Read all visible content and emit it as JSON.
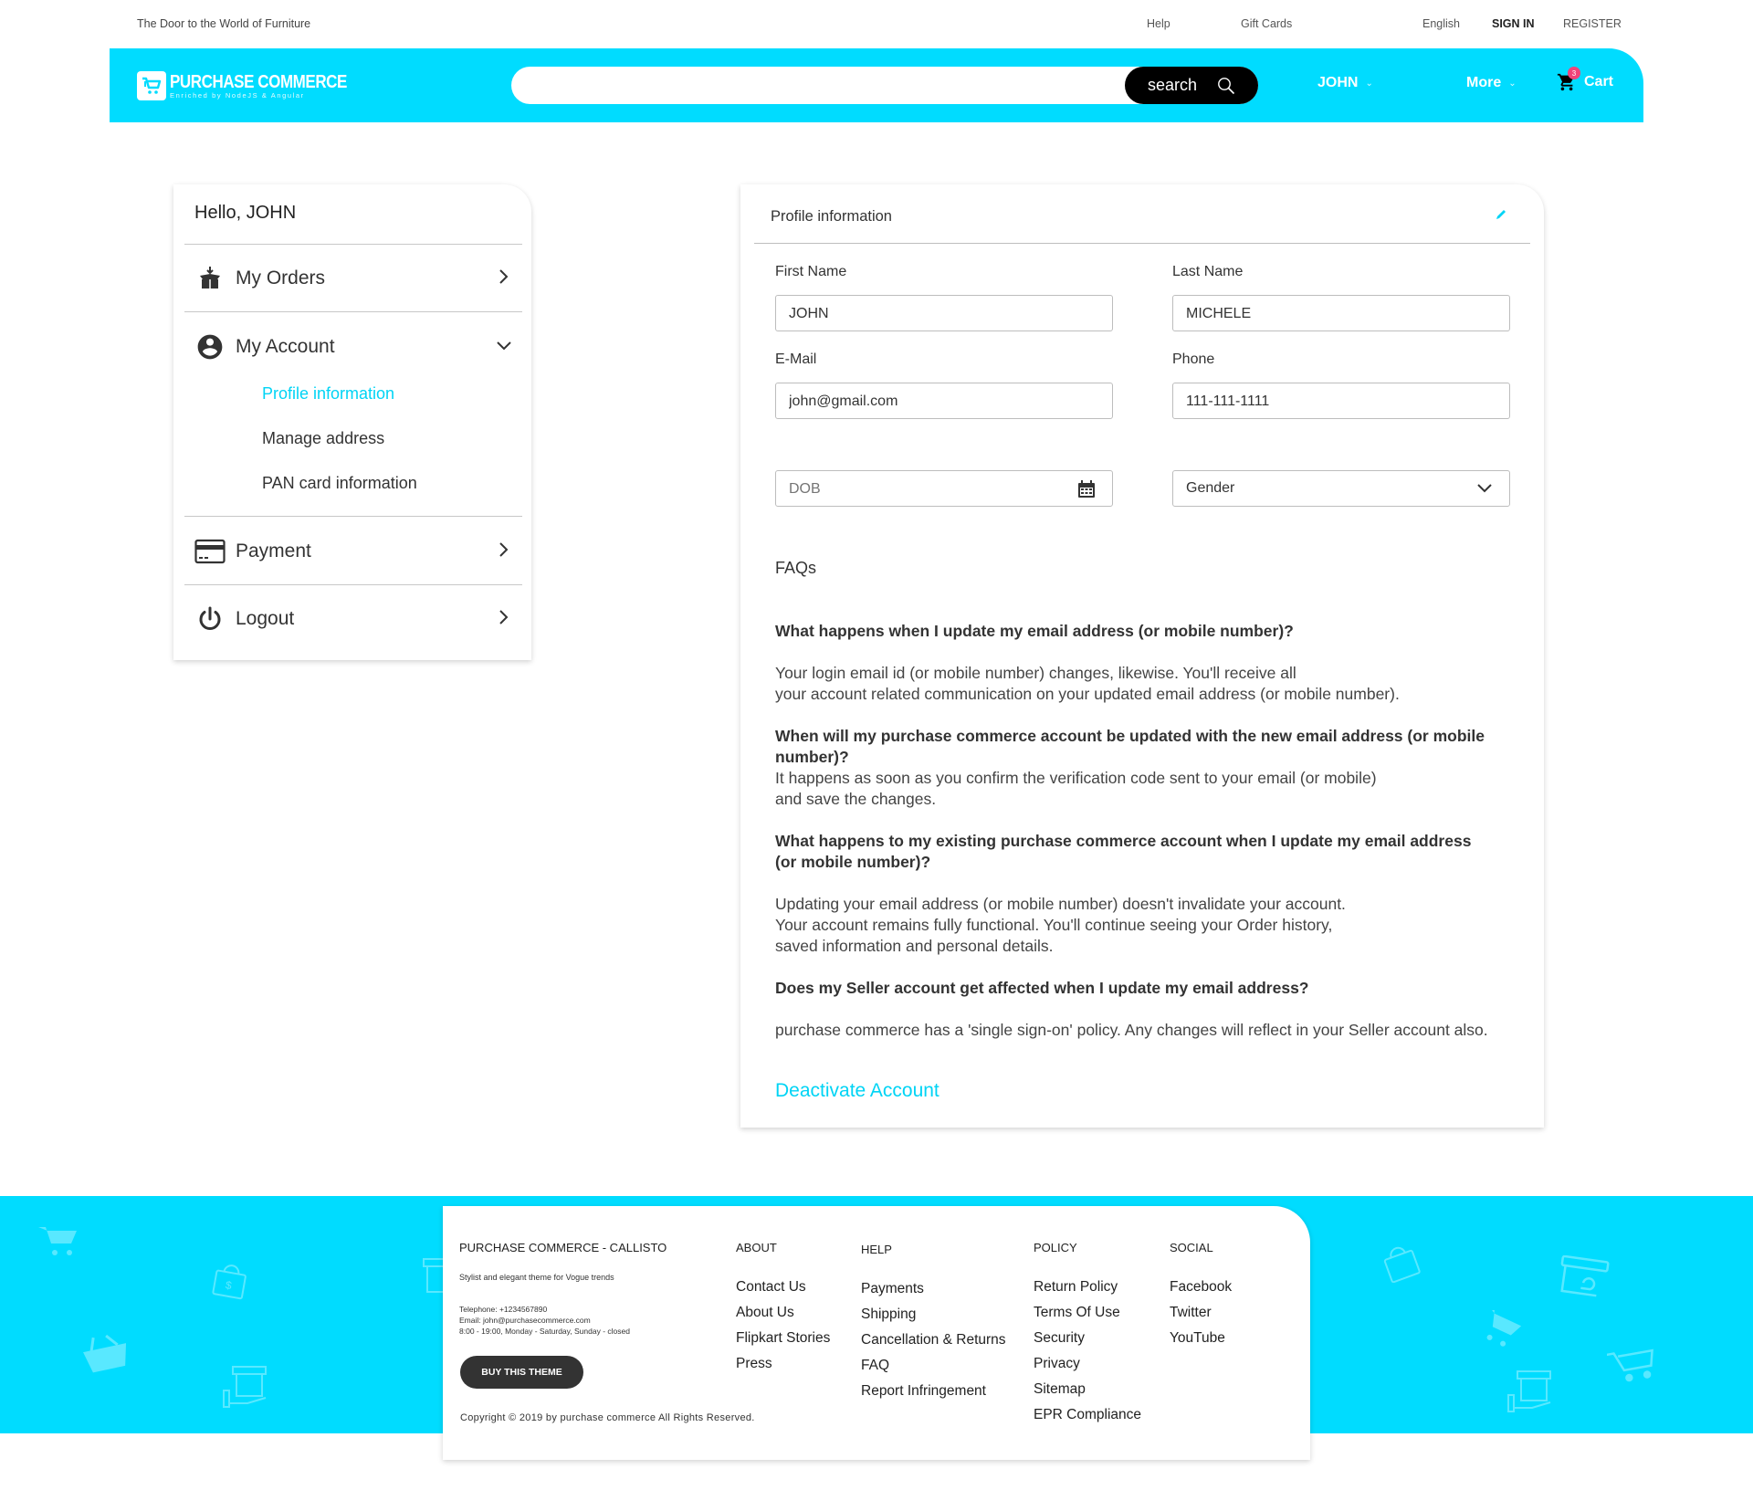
{
  "topbar": {
    "tagline": "The Door to the World of Furniture",
    "help": "Help",
    "gift_cards": "Gift Cards",
    "language": "English",
    "sign_in": "SIGN IN",
    "register": "REGISTER"
  },
  "header": {
    "logo_title": "PURCHASE COMMERCE",
    "logo_subtitle": "Enriched by NodeJS & Angular",
    "search_placeholder": "",
    "search_value": "",
    "search_button": "search",
    "user_menu": "JOHN",
    "more_menu": "More",
    "cart_label": "Cart",
    "cart_count": "3"
  },
  "sidebar": {
    "greeting": "Hello, JOHN",
    "items": [
      {
        "label": "My Orders",
        "icon": "open-box-icon"
      },
      {
        "label": "My Account",
        "icon": "account-circle-icon"
      },
      {
        "label": "Payment",
        "icon": "credit-card-icon"
      },
      {
        "label": "Logout",
        "icon": "power-icon"
      }
    ],
    "account_submenu": [
      {
        "label": "Profile information",
        "active": true
      },
      {
        "label": "Manage address",
        "active": false
      },
      {
        "label": "PAN card information",
        "active": false
      }
    ]
  },
  "profile": {
    "title": "Profile information",
    "fields": {
      "first_name": {
        "label": "First Name",
        "value": "JOHN"
      },
      "last_name": {
        "label": "Last Name",
        "value": "MICHELE"
      },
      "email": {
        "label": "E-Mail",
        "value": "john@gmail.com"
      },
      "phone": {
        "label": "Phone",
        "value": "111-111-1111"
      },
      "dob": {
        "placeholder": "DOB",
        "value": ""
      },
      "gender": {
        "selected": "Gender"
      }
    },
    "faqs_title": "FAQs",
    "faqs": [
      {
        "q": "What happens when I update my email address (or mobile number)?",
        "a": "Your login email id (or mobile number) changes, likewise. You'll receive all\nyour account related communication on your updated email address (or mobile number)."
      },
      {
        "q": "When will my purchase commerce account be updated with the new email address (or mobile number)?",
        "a": "It happens as soon as you confirm the verification code sent to your email (or mobile)\nand save the changes."
      },
      {
        "q": "What happens to my existing purchase commerce account when I update my email address\n(or mobile number)?",
        "a": "Updating your email address (or mobile number) doesn't invalidate your account.\nYour account remains fully functional. You'll continue seeing your Order history,\nsaved information and personal details."
      },
      {
        "q": "Does my Seller account get affected when I update my email address?",
        "a": "purchase commerce has a 'single sign-on' policy. Any changes will reflect in your Seller account also."
      }
    ],
    "deactivate": "Deactivate Account"
  },
  "footer": {
    "brand": "PURCHASE COMMERCE - CALLISTO",
    "tagline": "Stylist and elegant theme for Vogue trends",
    "telephone": "Telephone: +1234567890",
    "email": "Email: john@purchasecommerce.com",
    "hours": "8:00 - 19:00, Monday - Saturday, Sunday - closed",
    "buy_button": "BUY THIS THEME",
    "copyright": "Copyright © 2019 by purchase commerce All Rights Reserved.",
    "columns": [
      {
        "heading": "ABOUT",
        "links": [
          "Contact Us",
          "About Us",
          "Flipkart Stories",
          "Press"
        ]
      },
      {
        "heading": "HELP",
        "links": [
          "Payments",
          "Shipping",
          "Cancellation & Returns",
          "FAQ",
          "Report Infringement"
        ]
      },
      {
        "heading": "POLICY",
        "links": [
          "Return Policy",
          "Terms Of Use",
          "Security",
          "Privacy",
          "Sitemap",
          "EPR Compliance"
        ]
      },
      {
        "heading": "SOCIAL",
        "links": [
          "Facebook",
          "Twitter",
          "YouTube"
        ]
      }
    ]
  },
  "colors": {
    "brand": "#00dcff",
    "accent_text": "#00d4f5",
    "badge": "#f0447a",
    "search_button": "#000000",
    "buy_button": "#333333"
  }
}
